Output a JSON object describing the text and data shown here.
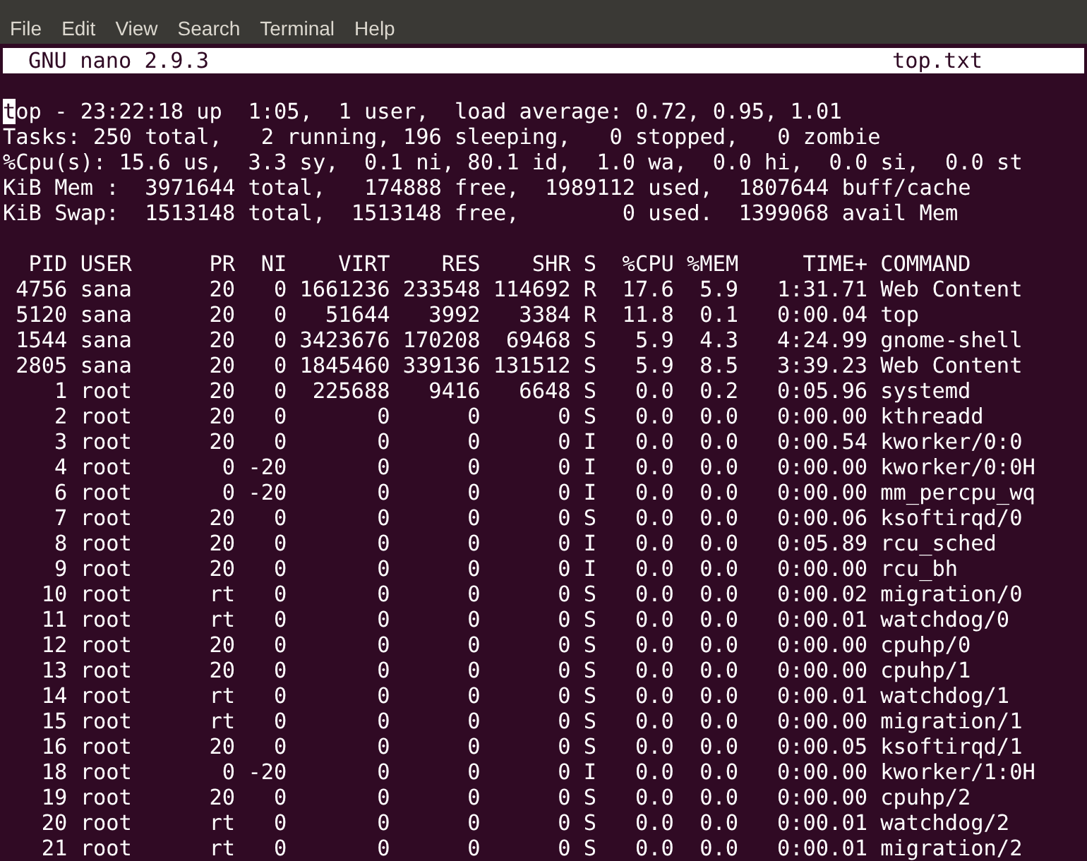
{
  "menu": [
    "File",
    "Edit",
    "View",
    "Search",
    "Terminal",
    "Help"
  ],
  "nano_header": {
    "version": "GNU nano 2.9.3",
    "filename": "top.txt"
  },
  "summary": [
    {
      "text": "top - 23:22:18 up  1:05,  1 user,  load average: 0.72, 0.95, 1.01",
      "cursor": true
    },
    {
      "text": "Tasks: 250 total,   2 running, 196 sleeping,   0 stopped,   0 zombie",
      "cursor": false
    },
    {
      "text": "%Cpu(s): 15.6 us,  3.3 sy,  0.1 ni, 80.1 id,  1.0 wa,  0.0 hi,  0.0 si,  0.0 st",
      "cursor": false
    },
    {
      "text": "KiB Mem :  3971644 total,   174888 free,  1989112 used,  1807644 buff/cache",
      "cursor": false
    },
    {
      "text": "KiB Swap:  1513148 total,  1513148 free,        0 used.  1399068 avail Mem",
      "cursor": false
    }
  ],
  "table": {
    "columns": [
      "PID",
      "USER",
      "PR",
      "NI",
      "VIRT",
      "RES",
      "SHR",
      "S",
      "%CPU",
      "%MEM",
      "TIME+",
      "COMMAND"
    ],
    "rows": [
      [
        "4756",
        "sana",
        "20",
        "0",
        "1661236",
        "233548",
        "114692",
        "R",
        "17.6",
        "5.9",
        "1:31.71",
        "Web Content"
      ],
      [
        "5120",
        "sana",
        "20",
        "0",
        "51644",
        "3992",
        "3384",
        "R",
        "11.8",
        "0.1",
        "0:00.04",
        "top"
      ],
      [
        "1544",
        "sana",
        "20",
        "0",
        "3423676",
        "170208",
        "69468",
        "S",
        "5.9",
        "4.3",
        "4:24.99",
        "gnome-shell"
      ],
      [
        "2805",
        "sana",
        "20",
        "0",
        "1845460",
        "339136",
        "131512",
        "S",
        "5.9",
        "8.5",
        "3:39.23",
        "Web Content"
      ],
      [
        "1",
        "root",
        "20",
        "0",
        "225688",
        "9416",
        "6648",
        "S",
        "0.0",
        "0.2",
        "0:05.96",
        "systemd"
      ],
      [
        "2",
        "root",
        "20",
        "0",
        "0",
        "0",
        "0",
        "S",
        "0.0",
        "0.0",
        "0:00.00",
        "kthreadd"
      ],
      [
        "3",
        "root",
        "20",
        "0",
        "0",
        "0",
        "0",
        "I",
        "0.0",
        "0.0",
        "0:00.54",
        "kworker/0:0"
      ],
      [
        "4",
        "root",
        "0",
        "-20",
        "0",
        "0",
        "0",
        "I",
        "0.0",
        "0.0",
        "0:00.00",
        "kworker/0:0H"
      ],
      [
        "6",
        "root",
        "0",
        "-20",
        "0",
        "0",
        "0",
        "I",
        "0.0",
        "0.0",
        "0:00.00",
        "mm_percpu_wq"
      ],
      [
        "7",
        "root",
        "20",
        "0",
        "0",
        "0",
        "0",
        "S",
        "0.0",
        "0.0",
        "0:00.06",
        "ksoftirqd/0"
      ],
      [
        "8",
        "root",
        "20",
        "0",
        "0",
        "0",
        "0",
        "I",
        "0.0",
        "0.0",
        "0:05.89",
        "rcu_sched"
      ],
      [
        "9",
        "root",
        "20",
        "0",
        "0",
        "0",
        "0",
        "I",
        "0.0",
        "0.0",
        "0:00.00",
        "rcu_bh"
      ],
      [
        "10",
        "root",
        "rt",
        "0",
        "0",
        "0",
        "0",
        "S",
        "0.0",
        "0.0",
        "0:00.02",
        "migration/0"
      ],
      [
        "11",
        "root",
        "rt",
        "0",
        "0",
        "0",
        "0",
        "S",
        "0.0",
        "0.0",
        "0:00.01",
        "watchdog/0"
      ],
      [
        "12",
        "root",
        "20",
        "0",
        "0",
        "0",
        "0",
        "S",
        "0.0",
        "0.0",
        "0:00.00",
        "cpuhp/0"
      ],
      [
        "13",
        "root",
        "20",
        "0",
        "0",
        "0",
        "0",
        "S",
        "0.0",
        "0.0",
        "0:00.00",
        "cpuhp/1"
      ],
      [
        "14",
        "root",
        "rt",
        "0",
        "0",
        "0",
        "0",
        "S",
        "0.0",
        "0.0",
        "0:00.01",
        "watchdog/1"
      ],
      [
        "15",
        "root",
        "rt",
        "0",
        "0",
        "0",
        "0",
        "S",
        "0.0",
        "0.0",
        "0:00.00",
        "migration/1"
      ],
      [
        "16",
        "root",
        "20",
        "0",
        "0",
        "0",
        "0",
        "S",
        "0.0",
        "0.0",
        "0:00.05",
        "ksoftirqd/1"
      ],
      [
        "18",
        "root",
        "0",
        "-20",
        "0",
        "0",
        "0",
        "I",
        "0.0",
        "0.0",
        "0:00.00",
        "kworker/1:0H"
      ],
      [
        "19",
        "root",
        "20",
        "0",
        "0",
        "0",
        "0",
        "S",
        "0.0",
        "0.0",
        "0:00.00",
        "cpuhp/2"
      ],
      [
        "20",
        "root",
        "rt",
        "0",
        "0",
        "0",
        "0",
        "S",
        "0.0",
        "0.0",
        "0:00.01",
        "watchdog/2"
      ],
      [
        "21",
        "root",
        "rt",
        "0",
        "0",
        "0",
        "0",
        "S",
        "0.0",
        "0.0",
        "0:00.01",
        "migration/2"
      ]
    ]
  }
}
